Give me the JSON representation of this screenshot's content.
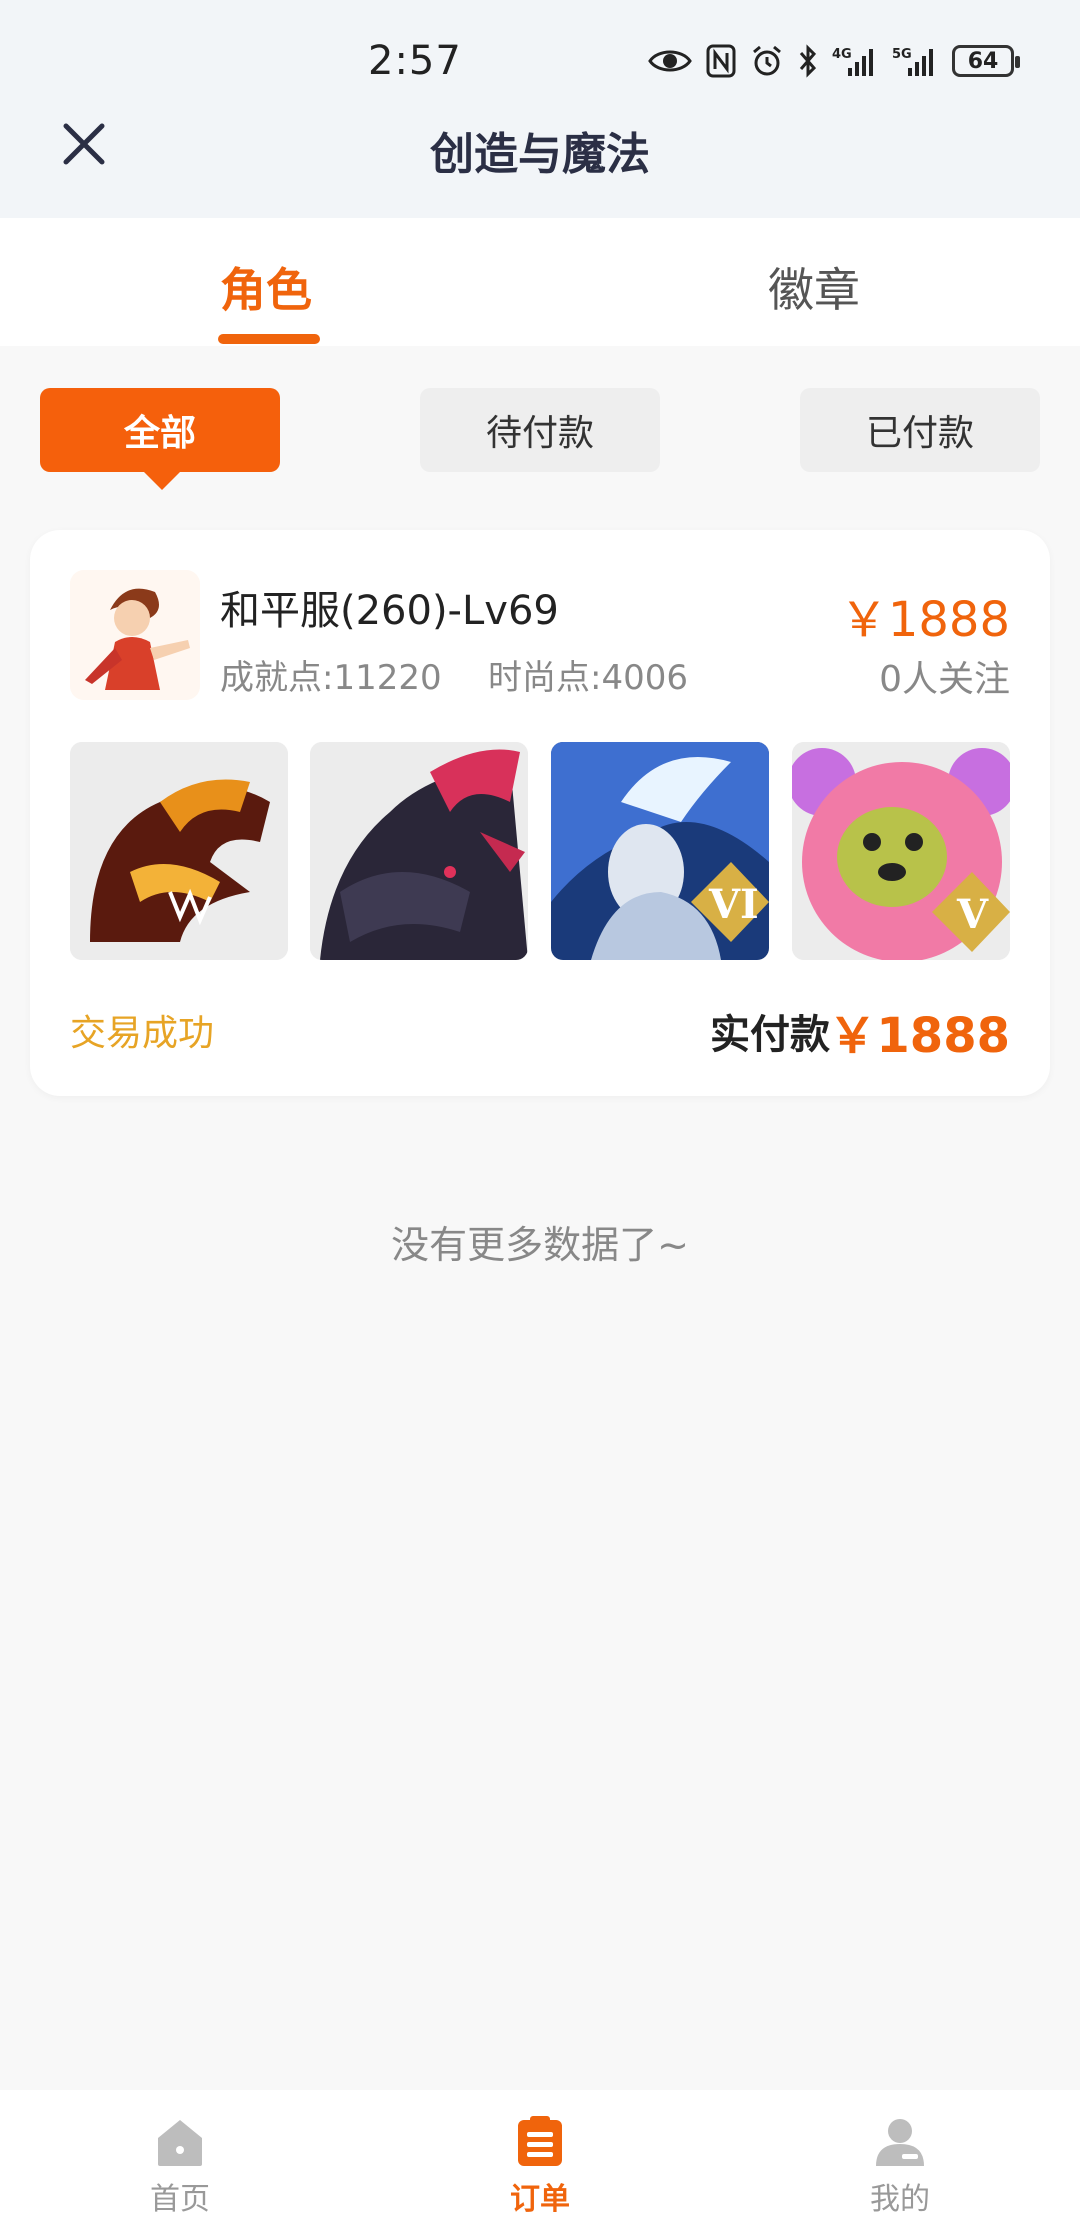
{
  "status_bar": {
    "time": "2:57",
    "battery": "64",
    "network_1": "4G",
    "network_2": "5G"
  },
  "header": {
    "title": "创造与魔法",
    "close_icon": "close-icon"
  },
  "tabs": [
    {
      "label": "角色",
      "active": true
    },
    {
      "label": "徽章",
      "active": false
    }
  ],
  "filters": [
    {
      "label": "全部",
      "active": true
    },
    {
      "label": "待付款",
      "active": false
    },
    {
      "label": "已付款",
      "active": false
    }
  ],
  "order": {
    "server": "和平服(260)-Lv69",
    "achievement": "成就点:11220",
    "fashion": "时尚点:4006",
    "price": "￥1888",
    "followers": "0人关注",
    "thumbnails": [
      {
        "name": "dragon-mount-fire"
      },
      {
        "name": "dragon-mount-dark"
      },
      {
        "name": "ice-armor-outfit",
        "badge": "VI"
      },
      {
        "name": "pink-bear-pet",
        "badge": "V"
      }
    ],
    "status": "交易成功",
    "paid_label": "实付款",
    "paid_amount": "￥1888"
  },
  "footer_text": "没有更多数据了~",
  "bottom_nav": [
    {
      "label": "首页",
      "icon": "home-icon",
      "active": false
    },
    {
      "label": "订单",
      "icon": "order-icon",
      "active": true
    },
    {
      "label": "我的",
      "icon": "profile-icon",
      "active": false
    }
  ],
  "colors": {
    "accent": "#f0640c",
    "status_success": "#e7a425",
    "chip_bg": "#eeeeee"
  }
}
